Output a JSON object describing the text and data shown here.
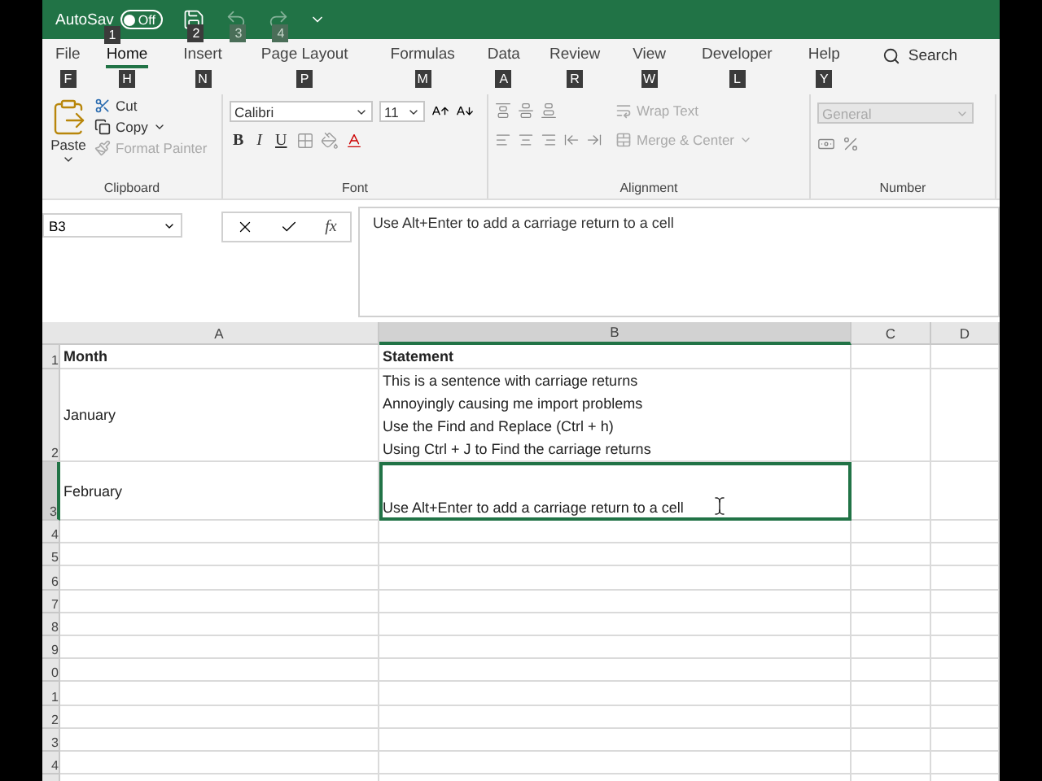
{
  "title_bar": {
    "autosave": {
      "label": "AutoSav",
      "state_label": "Off",
      "on": false
    },
    "keytips": [
      {
        "label": "1",
        "disabled": false
      },
      {
        "label": "2",
        "disabled": false
      },
      {
        "label": "3",
        "disabled": true
      },
      {
        "label": "4",
        "disabled": true
      }
    ]
  },
  "ribbon_tabs": [
    {
      "label": "File",
      "keytip": "F",
      "selected": false
    },
    {
      "label": "Home",
      "keytip": "H",
      "selected": true
    },
    {
      "label": "Insert",
      "keytip": "N",
      "selected": false
    },
    {
      "label": "Page Layout",
      "keytip": "P",
      "selected": false
    },
    {
      "label": "Formulas",
      "keytip": "M",
      "selected": false
    },
    {
      "label": "Data",
      "keytip": "A",
      "selected": false
    },
    {
      "label": "Review",
      "keytip": "R",
      "selected": false
    },
    {
      "label": "View",
      "keytip": "W",
      "selected": false
    },
    {
      "label": "Developer",
      "keytip": "L",
      "selected": false
    },
    {
      "label": "Help",
      "keytip": "Y",
      "selected": false
    }
  ],
  "search": {
    "label": "Search"
  },
  "ribbon": {
    "clipboard": {
      "title": "Clipboard",
      "paste": "Paste",
      "cut": "Cut",
      "copy": "Copy",
      "format_painter": {
        "label": "Format Painter",
        "disabled": true
      }
    },
    "font": {
      "title": "Font",
      "font_name": "Calibri",
      "font_size": "11",
      "bold": "B",
      "italic": "I",
      "underline": "U"
    },
    "alignment": {
      "title": "Alignment",
      "wrap_text": {
        "label": "Wrap Text",
        "disabled": true
      },
      "merge": {
        "label": "Merge & Center",
        "disabled": true
      }
    },
    "number": {
      "title": "Number",
      "format": {
        "value": "General",
        "disabled": true
      }
    }
  },
  "formula_bar": {
    "name_box": "B3",
    "fx": "fx",
    "content": "Use Alt+Enter to add a carriage return to a cell"
  },
  "sheet": {
    "columns": [
      {
        "label": "A",
        "selected": false
      },
      {
        "label": "B",
        "selected": true
      },
      {
        "label": "C",
        "selected": false
      },
      {
        "label": "D",
        "selected": false
      }
    ],
    "rows": [
      {
        "number": "1",
        "selected": false,
        "cells": [
          {
            "lines": [
              "Month"
            ],
            "bold": true,
            "active": false
          },
          {
            "lines": [
              "Statement"
            ],
            "bold": true,
            "active": false
          }
        ]
      },
      {
        "number": "2",
        "selected": false,
        "cells": [
          {
            "lines": [
              "January"
            ],
            "bold": false,
            "active": false
          },
          {
            "lines": [
              "This is a sentence with carriage returns",
              "Annoyingly causing me import problems",
              "Use the Find and Replace (Ctrl + h)",
              "Using Ctrl + J to Find the carriage returns"
            ],
            "bold": false,
            "active": false
          }
        ]
      },
      {
        "number": "3",
        "selected": true,
        "cells": [
          {
            "lines": [
              "February"
            ],
            "bold": false,
            "active": false
          },
          {
            "lines": [
              "Use Alt+Enter to add a carriage return to a cell"
            ],
            "bold": false,
            "active": true
          }
        ]
      },
      {
        "number": "4",
        "selected": false
      },
      {
        "number": "5",
        "selected": false
      },
      {
        "number": "6",
        "selected": false
      },
      {
        "number": "7",
        "selected": false
      },
      {
        "number": "8",
        "selected": false
      },
      {
        "number": "9",
        "selected": false
      },
      {
        "number": "0",
        "selected": false
      },
      {
        "number": "1",
        "selected": false
      },
      {
        "number": "2",
        "selected": false
      },
      {
        "number": "3",
        "selected": false
      },
      {
        "number": "4",
        "selected": false
      }
    ]
  }
}
